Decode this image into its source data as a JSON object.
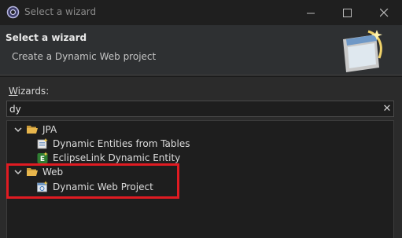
{
  "window": {
    "title": "Select a wizard"
  },
  "header": {
    "title": "Select a wizard",
    "description": "Create a Dynamic Web project"
  },
  "wizards": {
    "label_prefix": "W",
    "label_rest": "izards:",
    "filter_value": "dy",
    "clear_symbol": "✕"
  },
  "tree": {
    "jpa": {
      "label": "JPA",
      "children": [
        "Dynamic Entities from Tables",
        "EclipseLink Dynamic Entity"
      ]
    },
    "web": {
      "label": "Web",
      "children": [
        "Dynamic Web Project"
      ]
    }
  },
  "colors": {
    "highlight": "#e01b22",
    "folder": "#e8b64c",
    "background": "#2b2b2b"
  }
}
